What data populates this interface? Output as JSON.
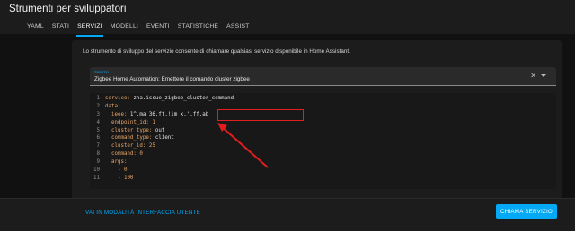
{
  "header": {
    "title": "Strumenti per sviluppatori"
  },
  "tabs": [
    {
      "label": "YAML"
    },
    {
      "label": "STATI"
    },
    {
      "label": "SERVIZI",
      "active": true
    },
    {
      "label": "MODELLI"
    },
    {
      "label": "EVENTI"
    },
    {
      "label": "STATISTICHE"
    },
    {
      "label": "ASSIST"
    }
  ],
  "card": {
    "description": "Lo strumento di sviluppo del servizio consente di chiamare qualsiasi servizio disponibile in Home Assistant.",
    "service_select": {
      "label": "Servizio",
      "value": "Zigbee Home Automation: Emettere il comando cluster zigbee"
    }
  },
  "editor": {
    "line_numbers": [
      "1",
      "2",
      "3",
      "4",
      "5",
      "6",
      "7",
      "8",
      "9",
      "10",
      "11"
    ],
    "lines": [
      {
        "key": "service:",
        "value": " zha.issue_zigbee_cluster_command"
      },
      {
        "key": "data:",
        "value": ""
      },
      {
        "key": "  ieee:",
        "value": " 1^.ma 36.ff.!im x.'.ff.ab"
      },
      {
        "key": "  endpoint_id:",
        "value": " 1"
      },
      {
        "key": "  cluster_type:",
        "value": " out"
      },
      {
        "key": "  command_type:",
        "value": " client"
      },
      {
        "key": "  cluster_id:",
        "value": " 25"
      },
      {
        "key": "  command:",
        "value": " 0"
      },
      {
        "key": "  args:",
        "value": ""
      },
      {
        "key": "    - ",
        "value": "0"
      },
      {
        "key": "    - ",
        "value": "100"
      }
    ]
  },
  "footer": {
    "ui_mode_link": "VAI IN MODALITÀ INTERFACCIA UTENTE",
    "call_service_button": "CHIAMA SERVIZIO"
  },
  "colors": {
    "accent": "#03a9f4",
    "annotation": "#e11d1d"
  }
}
